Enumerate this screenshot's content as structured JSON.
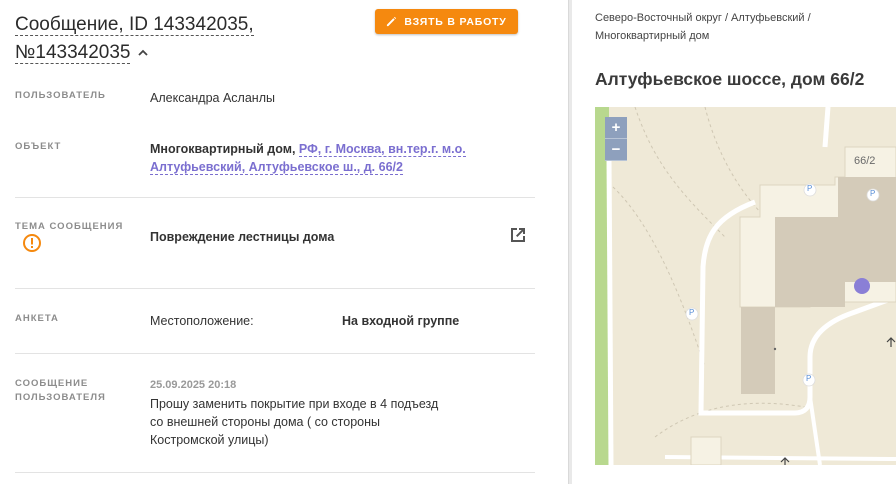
{
  "header": {
    "title": "Сообщение, ID 143342035, №143342035",
    "take_button_label": "ВЗЯТЬ В РАБОТУ"
  },
  "fields": {
    "user": {
      "label": "ПОЛЬЗОВАТЕЛЬ",
      "value": "Александра Асланлы"
    },
    "object": {
      "label": "ОБЪЕКТ",
      "type": "Многоквартирный дом,",
      "address_link": "РФ, г. Москва, вн.тер.г. м.о. Алтуфьевский, Алтуфьевское ш., д. 66/2"
    },
    "topic": {
      "label": "ТЕМА СООБЩЕНИЯ",
      "value": "Повреждение лестницы дома"
    },
    "survey": {
      "label": "АНКЕТА",
      "question": "Местоположение:",
      "answer": "На входной группе"
    },
    "message": {
      "label": "СООБЩЕНИЕ ПОЛЬЗОВАТЕЛЯ",
      "date": "25.09.2025 20:18",
      "text": "Прошу заменить покрытие при входе в 4 подъезд со внешней стороны дома ( со стороны Костромской улицы)"
    }
  },
  "right_panel": {
    "breadcrumbs": "Северо-Восточный округ / Алтуфьевский / Многоквартирный дом",
    "address": "Алтуфьевское шоссе, дом 66/2",
    "map": {
      "zoom_in": "+",
      "zoom_out": "−",
      "building_label": "66/2",
      "parking_label": "P",
      "marker_color": "#8a7fd6"
    }
  },
  "colors": {
    "accent": "#f5890f",
    "link": "#7b6fd0",
    "warning": "#f5890f"
  }
}
